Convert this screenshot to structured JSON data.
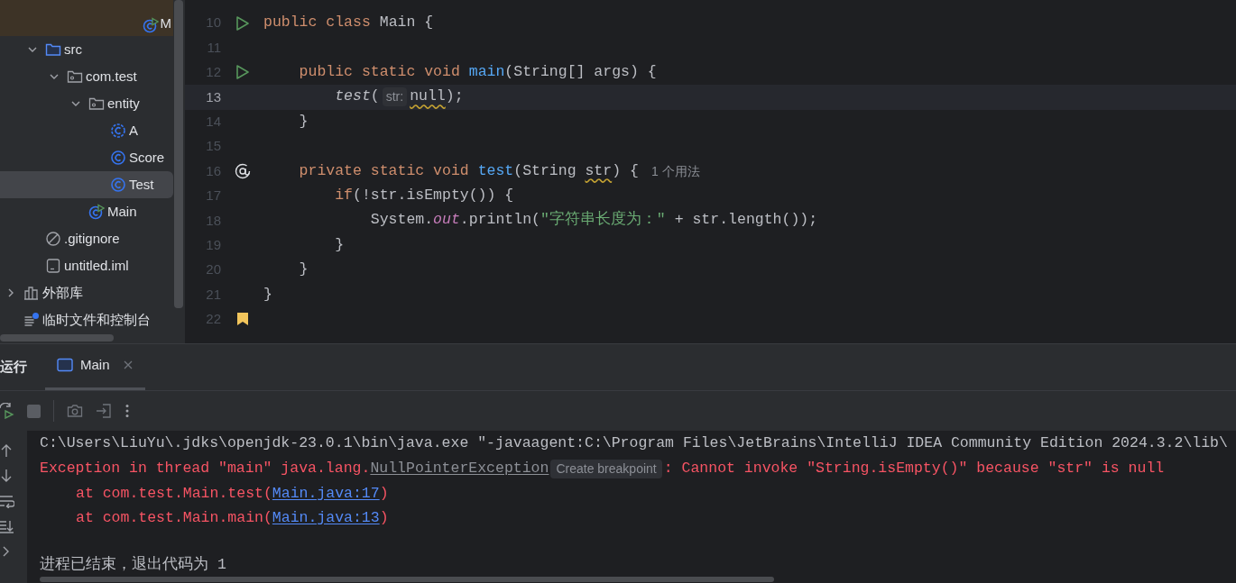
{
  "project_tree": {
    "top_item": {
      "label": "M",
      "kind": "run-class",
      "highlighted": true
    },
    "project_items": [
      {
        "label": "src",
        "kind": "source-folder",
        "expanded": true,
        "selected": false,
        "children": [
          {
            "label": "com.test",
            "kind": "package",
            "expanded": true,
            "selected": false,
            "children": [
              {
                "label": "entity",
                "kind": "package",
                "expanded": true,
                "selected": false,
                "children": [
                  {
                    "label": "A",
                    "kind": "class-dashed",
                    "selected": false
                  },
                  {
                    "label": "Score",
                    "kind": "class",
                    "selected": false
                  },
                  {
                    "label": "Test",
                    "kind": "class",
                    "selected": true
                  }
                ]
              },
              {
                "label": "Main",
                "kind": "run-class",
                "selected": false
              }
            ]
          }
        ]
      },
      {
        "label": ".gitignore",
        "kind": "ignored",
        "selected": false
      },
      {
        "label": "untitled.iml",
        "kind": "file",
        "selected": false
      }
    ],
    "root_items": [
      {
        "label": "外部库",
        "kind": "library",
        "expanded": false,
        "selected": false
      },
      {
        "label": "临时文件和控制台",
        "kind": "scratch",
        "selected": false
      }
    ]
  },
  "editor": {
    "lines": [
      {
        "number": "10",
        "kind": "run",
        "current": false,
        "tokens": [
          {
            "text": "public class ",
            "kind": "keyword"
          },
          {
            "text": "Main {",
            "kind": "plain"
          }
        ],
        "children": [
          {
            "number": "11",
            "current": false
          },
          {
            "number": "12",
            "kind": "run",
            "current": false,
            "tokens": [
              {
                "text": "public static void ",
                "kind": "keyword"
              },
              {
                "text": "main",
                "kind": "declaration"
              },
              {
                "text": "(String[] args) {",
                "kind": "plain"
              }
            ],
            "children": [
              {
                "number": "13",
                "current": true,
                "tokens": [
                  {
                    "text": "test",
                    "kind": "call"
                  },
                  {
                    "text": "(",
                    "kind": "plain"
                  },
                  {
                    "text": "str:",
                    "kind": "inlay"
                  },
                  {
                    "text": "null",
                    "kind": "warning"
                  },
                  {
                    "text": ");",
                    "kind": "plain"
                  }
                ]
              }
            ]
          },
          {
            "number": "14",
            "current": false,
            "tokens": [
              {
                "text": "}",
                "kind": "plain"
              }
            ]
          },
          {
            "number": "15",
            "current": false
          },
          {
            "number": "16",
            "kind": "implements",
            "current": false,
            "tokens": [
              {
                "text": "private static void ",
                "kind": "keyword"
              },
              {
                "text": "test",
                "kind": "declaration"
              },
              {
                "text": "(String ",
                "kind": "plain"
              },
              {
                "text": "str",
                "kind": "warning"
              },
              {
                "text": ") {",
                "kind": "plain"
              },
              {
                "text": "1 个用法",
                "kind": "usages"
              }
            ],
            "children": [
              {
                "number": "17",
                "current": false,
                "tokens": [
                  {
                    "text": "if",
                    "kind": "keyword"
                  },
                  {
                    "text": "(!str.isEmpty()) {",
                    "kind": "plain"
                  }
                ],
                "children": [
                  {
                    "number": "18",
                    "current": false,
                    "tokens": [
                      {
                        "text": "System.",
                        "kind": "plain"
                      },
                      {
                        "text": "out",
                        "kind": "static"
                      },
                      {
                        "text": ".println(",
                        "kind": "plain"
                      },
                      {
                        "text": "\"字符串长度为：\"",
                        "kind": "string"
                      },
                      {
                        "text": " + str.length());",
                        "kind": "plain"
                      }
                    ]
                  }
                ]
              },
              {
                "number": "19",
                "current": false,
                "tokens": [
                  {
                    "text": "}",
                    "kind": "plain"
                  }
                ]
              }
            ]
          },
          {
            "number": "20",
            "current": false,
            "tokens": [
              {
                "text": "}",
                "kind": "plain"
              }
            ]
          }
        ]
      },
      {
        "number": "21",
        "current": false,
        "tokens": [
          {
            "text": "}",
            "kind": "plain"
          }
        ]
      },
      {
        "number": "22",
        "kind": "bookmark",
        "current": false
      }
    ]
  },
  "run_panel": {
    "title": "运行",
    "tabs": [
      {
        "label": "Main",
        "selected": true
      }
    ],
    "console": [
      {
        "kind": "command",
        "tokens": [
          {
            "text": "C:\\Users\\LiuYu\\.jdks\\openjdk-23.0.1\\bin\\java.exe \"-javaagent:C:\\Program Files\\JetBrains\\IntelliJ IDEA Community Edition 2024.3.2\\lib\\",
            "kind": "plain"
          }
        ]
      },
      {
        "kind": "error",
        "tokens": [
          {
            "text": "Exception in thread \"main\" java.lang.",
            "kind": "error"
          },
          {
            "text": "NullPointerException",
            "kind": "class-link"
          },
          {
            "text": "Create breakpoint",
            "kind": "hint"
          },
          {
            "text": ": Cannot invoke \"String.isEmpty()\" because \"str\" is null",
            "kind": "error"
          }
        ]
      },
      {
        "kind": "trace",
        "tokens": [
          {
            "text": "at com.test.Main.test(",
            "kind": "error"
          },
          {
            "text": "Main.java:17",
            "kind": "link"
          },
          {
            "text": ")",
            "kind": "error"
          }
        ]
      },
      {
        "kind": "trace",
        "tokens": [
          {
            "text": "at com.test.Main.main(",
            "kind": "error"
          },
          {
            "text": "Main.java:13",
            "kind": "link"
          },
          {
            "text": ")",
            "kind": "error"
          }
        ]
      },
      {
        "kind": "exit",
        "tokens": [
          {
            "text": "进程已结束，退出代码为 1",
            "kind": "plain"
          }
        ]
      }
    ]
  }
}
